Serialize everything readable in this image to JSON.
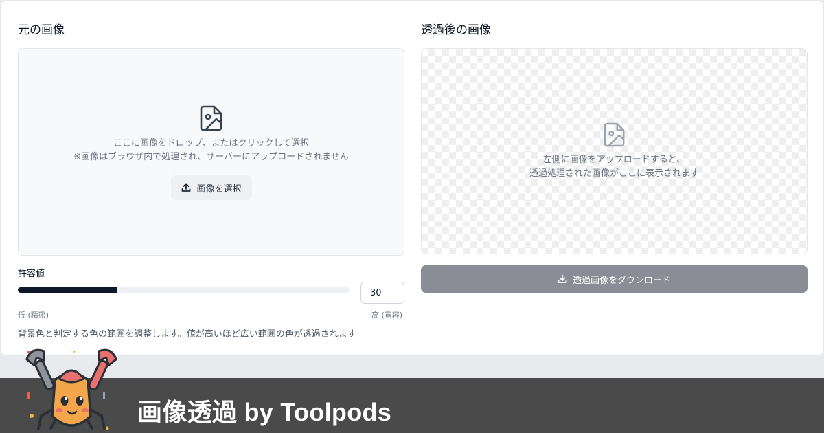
{
  "left_panel": {
    "title": "元の画像",
    "dropzone": {
      "line1": "ここに画像をドロップ、またはクリックして選択",
      "line2": "※画像はブラウザ内で処理され、サーバーにアップロードされません",
      "button_label": "画像を選択"
    },
    "tolerance": {
      "label": "許容値",
      "value": "30",
      "level_percent": 30,
      "low_label": "低 (精密)",
      "high_label": "高 (寛容)",
      "help": "背景色と判定する色の範囲を調整します。値が高いほど広い範囲の色が透過されます。"
    }
  },
  "right_panel": {
    "title": "透過後の画像",
    "placeholder_line1": "左側に画像をアップロードすると、",
    "placeholder_line2": "透過処理された画像がここに表示されます",
    "download_label": "透過画像をダウンロード"
  },
  "footer": {
    "brand": "画像透過 by Toolpods"
  },
  "icons": {
    "image_file": "image-file-icon",
    "upload": "upload-icon",
    "download": "download-icon",
    "mascot": "crab-mascot"
  },
  "colors": {
    "slider_fill": "#0f172a",
    "download_button": "#8a8d95",
    "footer_bg": "#4a4a4a"
  }
}
